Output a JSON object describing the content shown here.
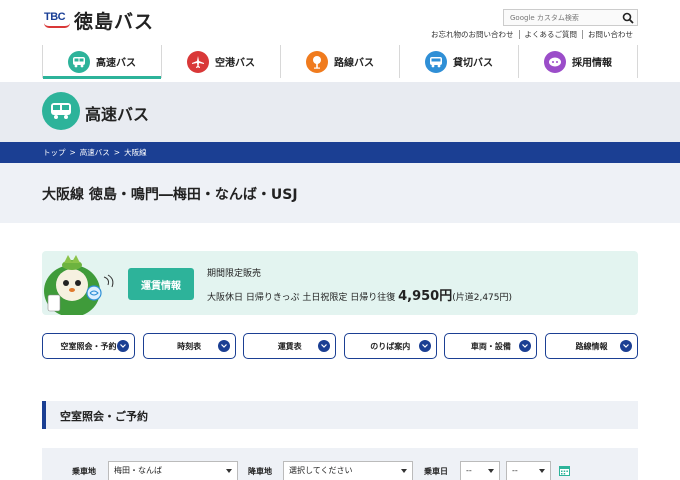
{
  "header": {
    "logo_mark": "TBC",
    "logo_text": "徳島バス",
    "search_placeholder": "Google カスタム検索",
    "util_links": [
      "お忘れ物のお問い合わせ",
      "よくあるご質問",
      "お問い合わせ"
    ]
  },
  "gnav": [
    {
      "label": "高速バス",
      "icon": "bus-icon",
      "color": "#2db39a",
      "active": true
    },
    {
      "label": "空港バス",
      "icon": "airplane-icon",
      "color": "#d93838",
      "active": false
    },
    {
      "label": "路線バス",
      "icon": "bus-stop-icon",
      "color": "#f07b1e",
      "active": false
    },
    {
      "label": "貸切バス",
      "icon": "charter-bus-icon",
      "color": "#2f8fd6",
      "active": false
    },
    {
      "label": "採用情報",
      "icon": "person-icon",
      "color": "#9b4dc9",
      "active": false
    }
  ],
  "page": {
    "title": "高速バス",
    "route_title": "大阪線 徳島・鳴門―梅田・なんば・USJ"
  },
  "breadcrumb": [
    "トップ",
    "高速バス",
    "大阪線"
  ],
  "breadcrumb_sep": ">",
  "notice": {
    "button_label": "運賃情報",
    "line1": "期間限定販売",
    "line2_prefix": "大阪休日 日帰りきっぷ 土日祝限定 日帰り往復",
    "price": "4,950円",
    "line2_suffix": "(片道2,475円)"
  },
  "anchors": [
    "空室照会・予約",
    "時刻表",
    "運賃表",
    "のりば案内",
    "車両・設備",
    "路線情報"
  ],
  "section": {
    "title": "空室照会・ご予約"
  },
  "form": {
    "boarding_label": "乗車地",
    "boarding_value": "梅田・なんば",
    "alighting_label": "降車地",
    "alighting_value": "選択してください",
    "date_label": "乗車日",
    "month_value": "--",
    "day_value": "--"
  },
  "colors": {
    "accent": "#2db39a",
    "navy": "#1b3f93",
    "band": "#e8ebf1"
  }
}
